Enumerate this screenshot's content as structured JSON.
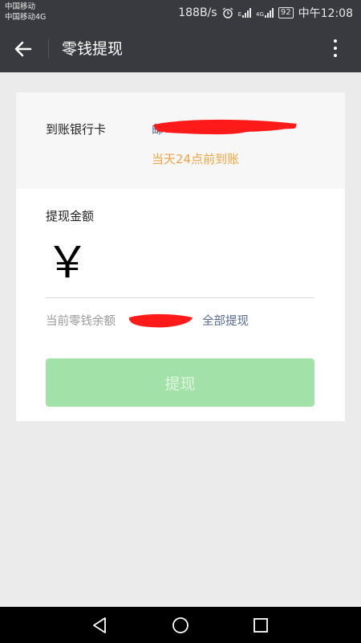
{
  "status_bar": {
    "carrier_1": "中国移动",
    "carrier_2": "中国移动4G",
    "speed": "188B/s",
    "network_1": "E",
    "network_2": "4G",
    "battery": "92",
    "time": "中午12:08"
  },
  "app_bar": {
    "back_icon": "arrow-left-icon",
    "title": "零钱提现",
    "more_icon": "more-vertical-icon"
  },
  "bank": {
    "label": "到账银行卡",
    "name_partial": "邮",
    "arrival_time": "当天24点前到账"
  },
  "amount": {
    "label": "提现金额",
    "currency_symbol": "￥",
    "value": ""
  },
  "balance": {
    "text": "当前零钱余额",
    "separator": "，",
    "withdraw_all_label": "全部提现"
  },
  "submit_label": "提现",
  "colors": {
    "bar_bg": "#393a3f",
    "link": "#576b95",
    "orange": "#f0a541",
    "button_disabled": "#a2e2a8",
    "redaction": "#ff1a1a"
  },
  "nav": [
    "back-triangle-icon",
    "home-circle-icon",
    "recent-square-icon"
  ]
}
